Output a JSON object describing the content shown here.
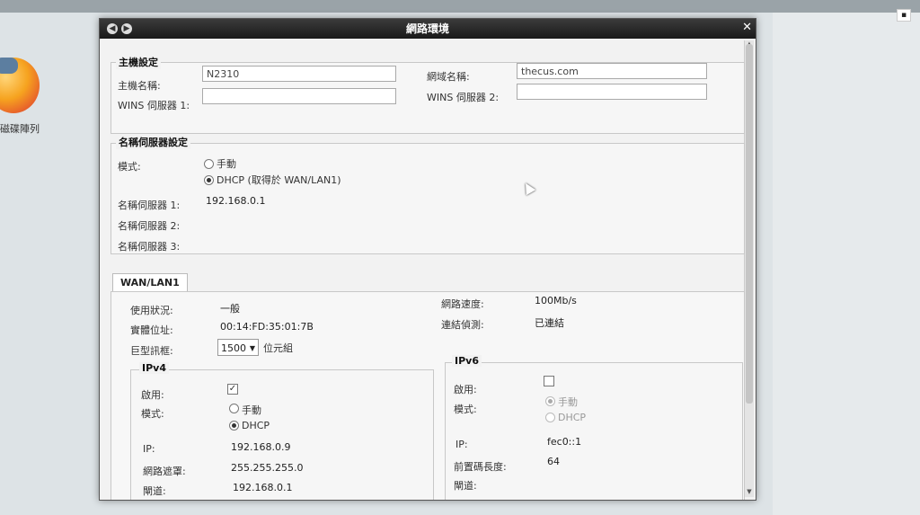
{
  "desktop": {
    "icon_label": "磁碟陣列"
  },
  "dialog": {
    "title": "網路環境",
    "host": {
      "legend": "主機設定",
      "hostname_label": "主機名稱:",
      "hostname_value": "N2310",
      "domain_label": "網域名稱:",
      "domain_value": "thecus.com",
      "wins1_label": "WINS 伺服器 1:",
      "wins1_value": "",
      "wins2_label": "WINS 伺服器 2:",
      "wins2_value": ""
    },
    "dns": {
      "legend": "名稱伺服器設定",
      "mode_label": "模式:",
      "manual_label": "手動",
      "dhcp_label": "DHCP (取得於 WAN/LAN1)",
      "mode_selected": "dhcp",
      "dns1_label": "名稱伺服器 1:",
      "dns1_value": "192.168.0.1",
      "dns2_label": "名稱伺服器 2:",
      "dns2_value": "",
      "dns3_label": "名稱伺服器 3:",
      "dns3_value": ""
    },
    "wan": {
      "tab_label": "WAN/LAN1",
      "usage_label": "使用狀況:",
      "usage_value": "一般",
      "mac_label": "實體位址:",
      "mac_value": "00:14:FD:35:01:7B",
      "jumbo_label": "巨型訊框:",
      "jumbo_value": "1500",
      "jumbo_unit": "位元組",
      "speed_label": "網路速度:",
      "speed_value": "100Mb/s",
      "link_label": "連結偵測:",
      "link_value": "已連結"
    },
    "ipv4": {
      "legend": "IPv4",
      "enable_label": "啟用:",
      "enabled": true,
      "mode_label": "模式:",
      "manual_label": "手動",
      "dhcp_label": "DHCP",
      "mode_selected": "dhcp",
      "ip_label": "IP:",
      "ip_value": "192.168.0.9",
      "netmask_label": "網路遮罩:",
      "netmask_value": "255.255.255.0",
      "gateway_label": "閘道:",
      "gateway_value": "192.168.0.1"
    },
    "ipv6": {
      "legend": "IPv6",
      "enable_label": "啟用:",
      "enabled": false,
      "mode_label": "模式:",
      "manual_label": "手動",
      "dhcp_label": "DHCP",
      "mode_selected": "manual",
      "ip_label": "IP:",
      "ip_value": "fec0::1",
      "prefix_label": "前置碼長度:",
      "prefix_value": "64",
      "gateway_label": "閘道:",
      "gateway_value": ""
    }
  }
}
